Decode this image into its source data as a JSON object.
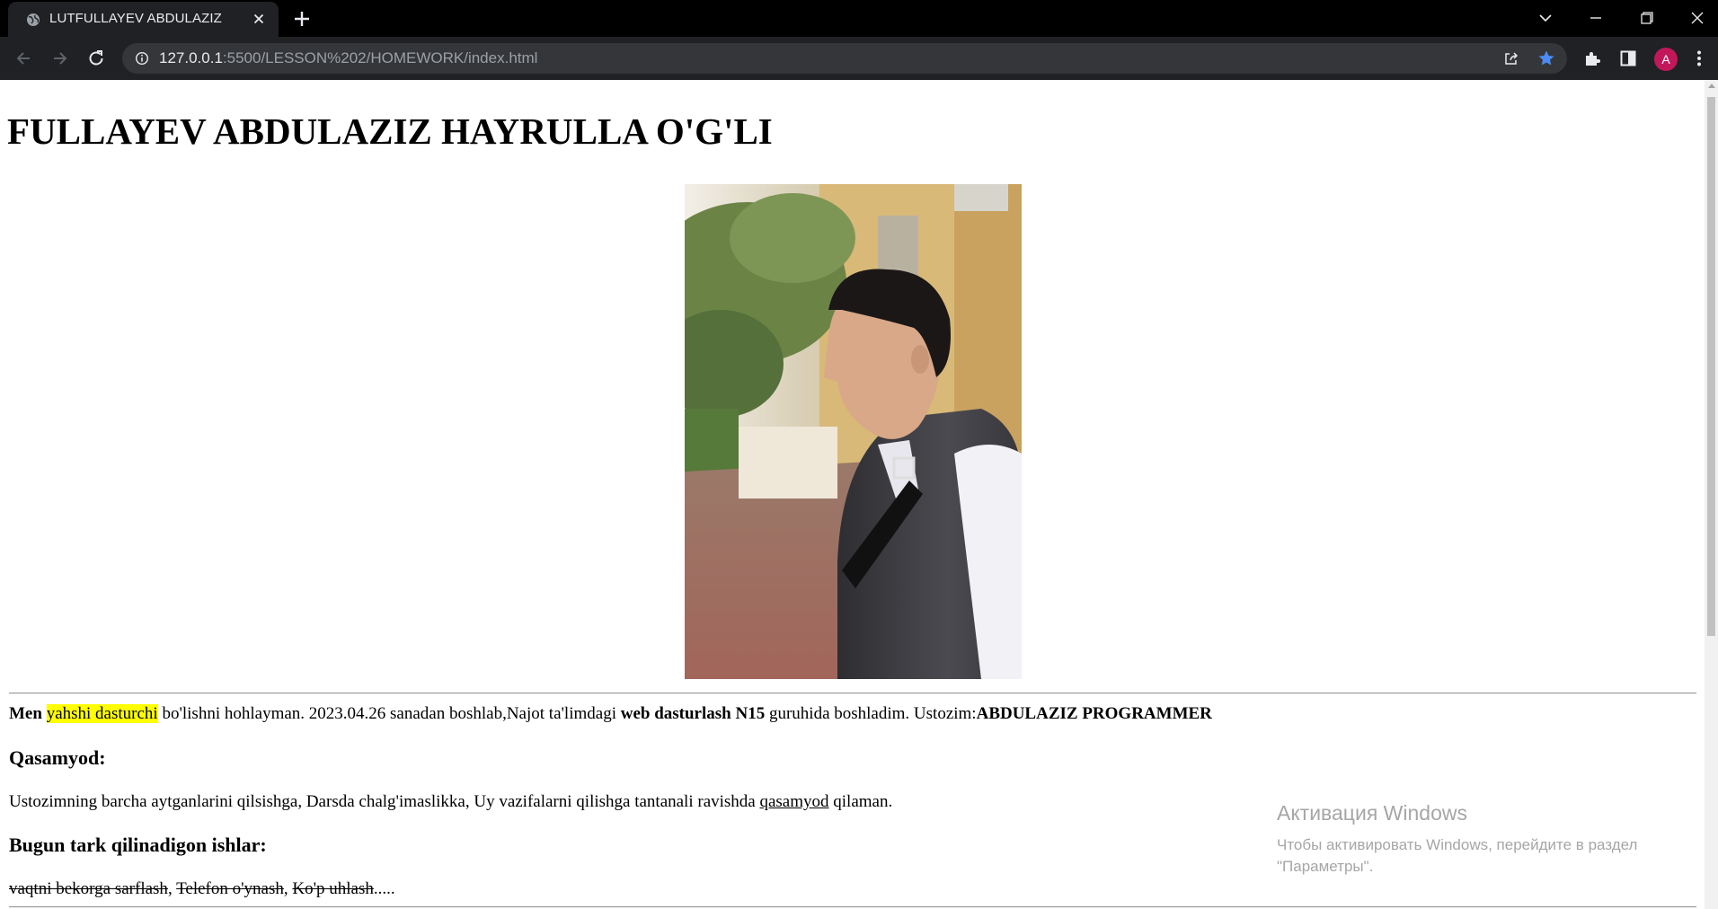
{
  "browser": {
    "tab_title": "LUTFULLAYEV ABDULAZIZ",
    "url_host": "127.0.0.1",
    "url_path": ":5500/LESSON%202/HOMEWORK/index.html",
    "profile_initial": "A",
    "icons": [
      "globe-icon",
      "close-icon",
      "plus-icon",
      "chevron-down-icon",
      "minimize-icon",
      "restore-icon",
      "close-window-icon",
      "back-arrow-icon",
      "forward-arrow-icon",
      "reload-icon",
      "info-icon",
      "share-icon",
      "star-icon",
      "extensions-puzzle-icon",
      "side-panel-icon",
      "kebab-menu-icon"
    ],
    "colors": {
      "titlebar": "#000000",
      "toolbar": "#202124",
      "omnibox": "#35363a",
      "star": "#4c8bf5",
      "avatar": "#c2185b"
    }
  },
  "page": {
    "title": "FULLAYEV ABDULAZIZ HAYRULLA O'G'LI",
    "intro": {
      "bold1": "Men",
      "highlight": "yahshi dasturchi",
      "text1": " bo'lishni hohlayman. 2023.04.26 sanadan boshlab,Najot ta'limdagi ",
      "bold2": "web dasturlash N15",
      "text2": " guruhida boshladim. Ustozim:",
      "bold3": "ABDULAZIZ PROGRAMMER"
    },
    "oath_heading": "Qasamyod:",
    "oath": {
      "text1": "Ustozimning barcha aytganlarini qilsishga, Darsda chalg'imaslikka, Uy vazifalarni qilishga tantanali ravishda ",
      "underlined": "qasamyod",
      "text2": " qilaman."
    },
    "quit_heading": "Bugun tark qilinadigon ishlar:",
    "quit": {
      "item1": "vaqtni bekorga sarflash",
      "sep1": ", ",
      "item2": "Telefon o'ynash",
      "sep2": ", ",
      "item3": "Ko'p uhlash",
      "tail": "....."
    },
    "highlight_color": "#ffff00"
  },
  "os_overlay": {
    "title": "Активация Windows",
    "subtitle": "Чтобы активировать Windows, перейдите в раздел \"Параметры\"."
  }
}
